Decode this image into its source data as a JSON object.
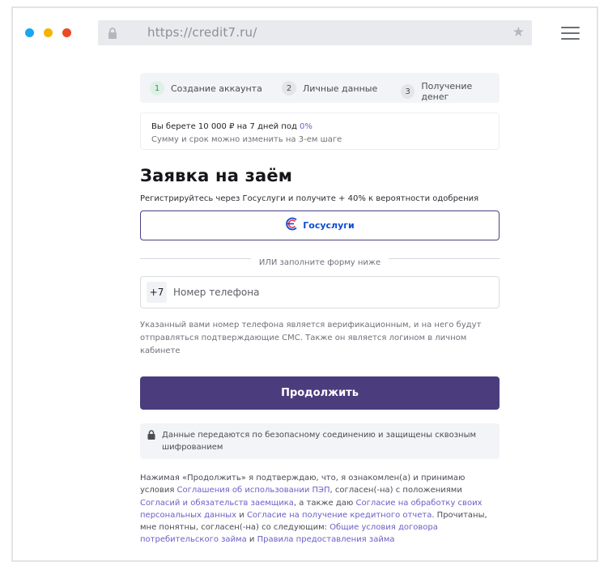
{
  "browser": {
    "url": "https://credit7.ru/"
  },
  "steps": [
    {
      "num": "1",
      "label": "Создание аккаунта"
    },
    {
      "num": "2",
      "label": "Личные данные"
    },
    {
      "num": "3",
      "label": "Получение денег"
    }
  ],
  "loan_info": {
    "line1_prefix": "Вы берете 10 000 ₽ на 7 дней под ",
    "percent": "0%",
    "line2": "Сумму и срок можно изменить на 3-ем шаге"
  },
  "title": "Заявка на заём",
  "gosuslugi_note": "Регистрируйтесь через Госуслуги и получите + 40% к вероятности одобрения",
  "gosuslugi_button": "Госуслуги",
  "divider_text": "ИЛИ заполните форму ниже",
  "phone": {
    "prefix": "+7",
    "placeholder": "Номер телефона",
    "value": ""
  },
  "phone_note": "Указанный вами номер телефона является верификационным, и на него будут отправляться подтверждающие СМС. Также он является логином в личном кабинете",
  "continue_button": "Продолжить",
  "secure_note": "Данные передаются по безопасному соединению и защищены сквозным шифрованием",
  "legal": {
    "t1": "Нажимая «Продолжить» я подтверждаю, что, я ознакомлен(а) и принимаю условия ",
    "l1": "Соглашения об использовании ПЭП",
    "t2": ", согласен(-на) с положениями ",
    "l2": "Согласий и обязательств заемщика",
    "t3": ", а также даю ",
    "l3": "Согласие на обработку своих персональных данных",
    "t4": " и ",
    "l4": "Согласие на получение кредитного отчета",
    "t5": ". Прочитаны, мне понятны, согласен(-на) со следующим: ",
    "l5": "Общие условия договора потребительского займа",
    "t6": " и ",
    "l6": "Правила предоставления займа"
  },
  "colors": {
    "accent": "#4b3d7d",
    "link": "#6b5fc6",
    "gosuslugi_blue": "#0d4cd3",
    "gosuslugi_red": "#ee3f58"
  }
}
